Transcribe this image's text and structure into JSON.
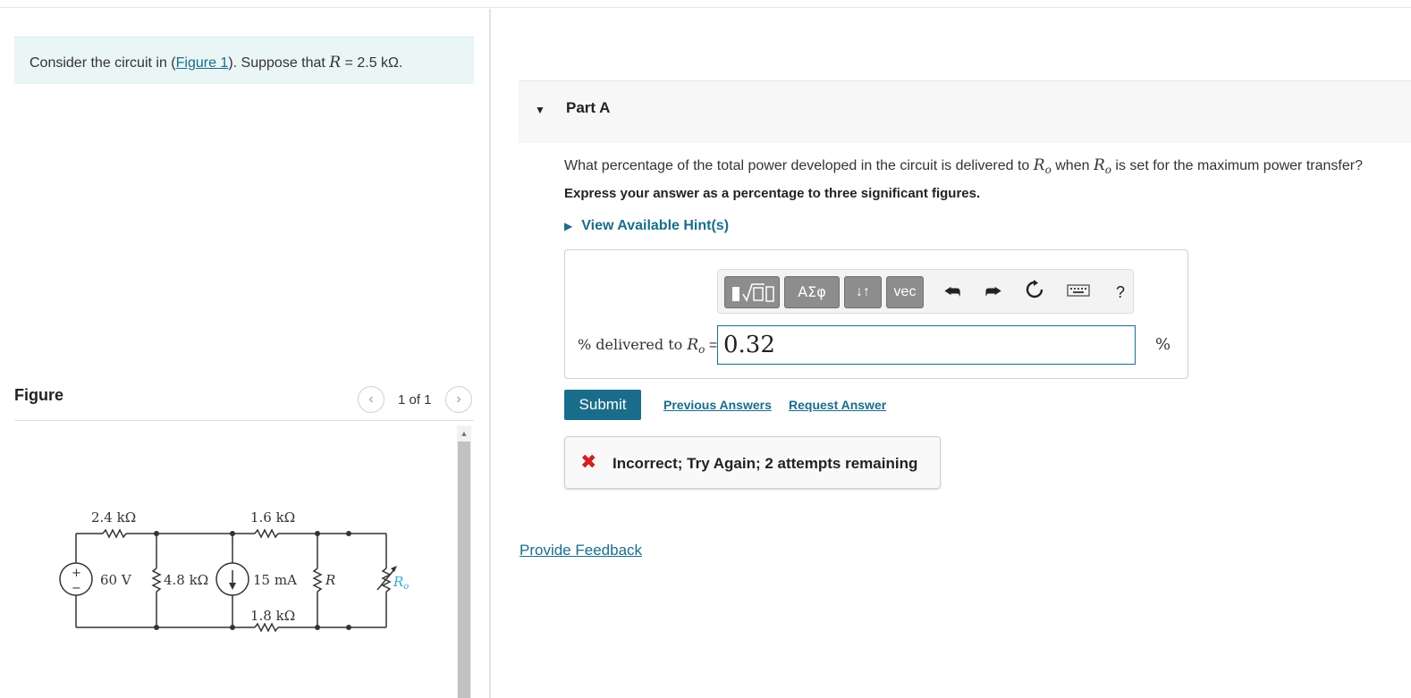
{
  "problem": {
    "prefix": "Consider the circuit in (",
    "figure_link": "Figure 1",
    "middle": "). Suppose that ",
    "var": "R",
    "equals": " = 2.5 kΩ."
  },
  "figure": {
    "title": "Figure",
    "counter": "1 of 1",
    "prev_icon": "chevron-left-icon",
    "next_icon": "chevron-right-icon"
  },
  "circuit": {
    "r1": "2.4 kΩ",
    "r2": "1.6 kΩ",
    "r3": "1.8 kΩ",
    "r4": "4.8 kΩ",
    "source_v": "60 V",
    "source_i": "15 mA",
    "r_var": "R",
    "r_load": "R",
    "r_load_sub": "o",
    "plus": "+",
    "minus": "−"
  },
  "part": {
    "title": "Part A",
    "caret_icon": "caret-down-icon"
  },
  "question": {
    "text1": "What percentage of the total power developed in the circuit is delivered to ",
    "var": "R",
    "sub": "o",
    "text2": " when ",
    "text3": " is set for the maximum power transfer?"
  },
  "instruction": "Express your answer as a percentage to three significant figures.",
  "hint": "View Available Hint(s)",
  "toolbar": {
    "templates_icon": "templates-icon",
    "greek_label": "ΑΣφ",
    "arrows_label": "↓↑",
    "vec_label": "vec",
    "undo_icon": "undo-icon",
    "redo_icon": "redo-icon",
    "reset_icon": "reset-icon",
    "keyboard_icon": "keyboard-icon",
    "help_label": "?"
  },
  "answer": {
    "label_prefix": "% delivered to ",
    "var": "R",
    "sub": "o",
    "label_suffix": " =",
    "value": "0.32",
    "unit": "%"
  },
  "actions": {
    "submit": "Submit",
    "previous": "Previous Answers",
    "request": "Request Answer"
  },
  "feedback": {
    "icon": "x-icon",
    "symbol": "✖",
    "text": "Incorrect; Try Again; 2 attempts remaining"
  },
  "footer": {
    "provide_feedback": "Provide Feedback"
  },
  "colors": {
    "accent": "#1a6d8a",
    "error": "#d21f1f",
    "problem_bg": "#eaf5f6"
  }
}
